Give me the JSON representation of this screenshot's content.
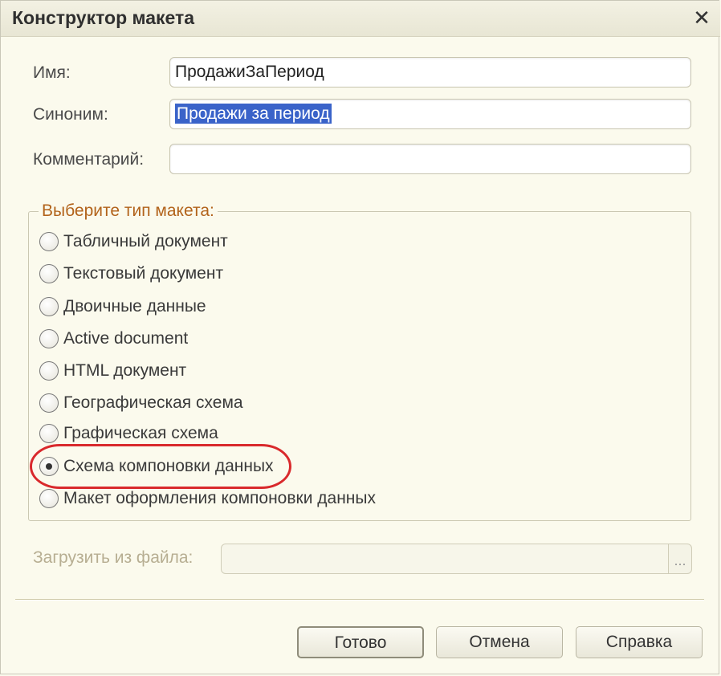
{
  "window": {
    "title": "Конструктор макета",
    "close_glyph": "✕"
  },
  "form": {
    "name_label": "Имя:",
    "name_value": "ПродажиЗаПериод",
    "synonym_label": "Синоним:",
    "synonym_value": "Продажи за период",
    "comment_label": "Комментарий:",
    "comment_value": ""
  },
  "type_group": {
    "legend": "Выберите тип макета:",
    "options": [
      {
        "label": "Табличный документ",
        "checked": false
      },
      {
        "label": "Текстовый документ",
        "checked": false
      },
      {
        "label": "Двоичные данные",
        "checked": false
      },
      {
        "label": "Active document",
        "checked": false
      },
      {
        "label": "HTML документ",
        "checked": false
      },
      {
        "label": "Географическая схема",
        "checked": false
      },
      {
        "label": "Графическая схема",
        "checked": false
      },
      {
        "label": "Схема компоновки данных",
        "checked": true
      },
      {
        "label": "Макет оформления компоновки данных",
        "checked": false
      }
    ]
  },
  "file": {
    "label": "Загрузить из файла:",
    "value": "",
    "browse_label": "..."
  },
  "buttons": {
    "ok": "Готово",
    "cancel": "Отмена",
    "help": "Справка"
  },
  "colors": {
    "accent_highlight": "#d9292c",
    "selection": "#3a63c9",
    "legend": "#b2631b"
  }
}
